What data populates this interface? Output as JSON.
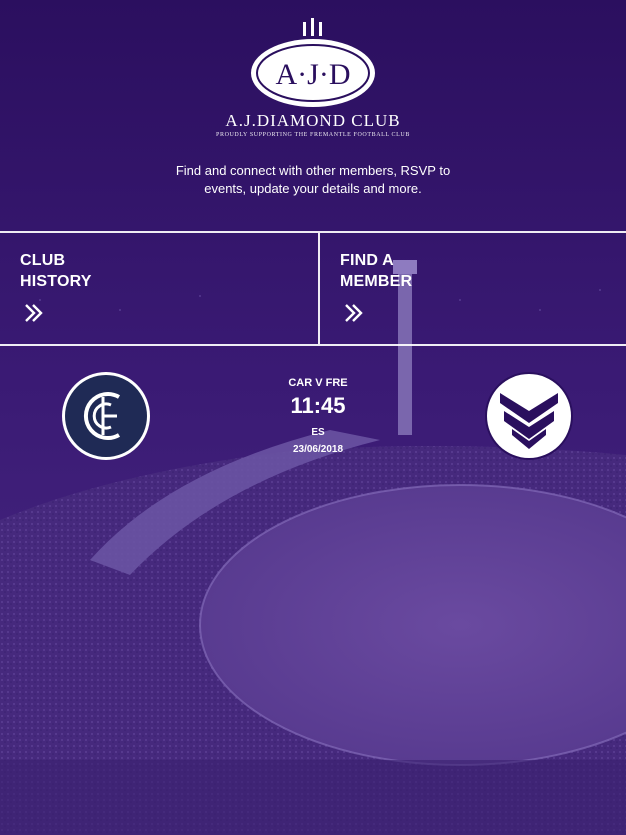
{
  "brand": {
    "logo_letters": "A·J·D",
    "name": "A.J.DIAMOND CLUB",
    "tagline": "PROUDLY SUPPORTING THE FREMANTLE FOOTBALL CLUB"
  },
  "intro_text": "Find and connect with other members, RSVP to events, update your details and more.",
  "tiles": [
    {
      "line1": "CLUB",
      "line2": "HISTORY",
      "icon": "double-chevron-right-icon"
    },
    {
      "line1": "FIND A",
      "line2": "MEMBER",
      "icon": "double-chevron-right-icon"
    }
  ],
  "match": {
    "title": "CAR V FRE",
    "time": "11:45",
    "venue": "ES",
    "date": "23/06/2018",
    "home_logo": "carlton-logo",
    "away_logo": "fremantle-logo"
  },
  "colors": {
    "brand_purple": "#2a0f5e",
    "overlay_purple": "#3b1a7a",
    "carlton_navy": "#1f2a55"
  }
}
